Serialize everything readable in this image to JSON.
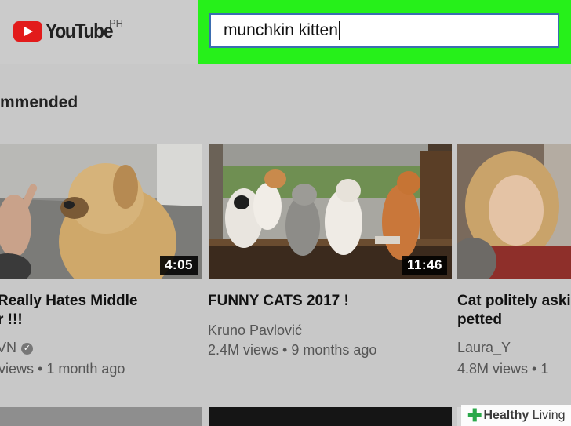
{
  "header": {
    "logo_text": "YouTube",
    "region": "PH"
  },
  "search": {
    "query": "munchkin kitten"
  },
  "section": {
    "title": "mmended"
  },
  "videos": [
    {
      "duration": "4:05",
      "title_line1": "Really Hates Middle",
      "title_line2": "r !!!",
      "channel": "VN",
      "views": "views",
      "age": "1 month ago"
    },
    {
      "duration": "11:46",
      "title_line1": "FUNNY CATS 2017 !",
      "channel": "Kruno Pavlović",
      "views": "2.4M views",
      "age": "9 months ago"
    },
    {
      "title_line1": "Cat politely aski",
      "title_line2": "petted",
      "channel": "Laura_Y",
      "views": "4.8M views",
      "age": "1"
    }
  ],
  "watermark": {
    "brand_bold": "Healthy",
    "brand_light": "Living"
  },
  "colors": {
    "highlight": "#26f01a",
    "youtube_red": "#e21b1b"
  }
}
